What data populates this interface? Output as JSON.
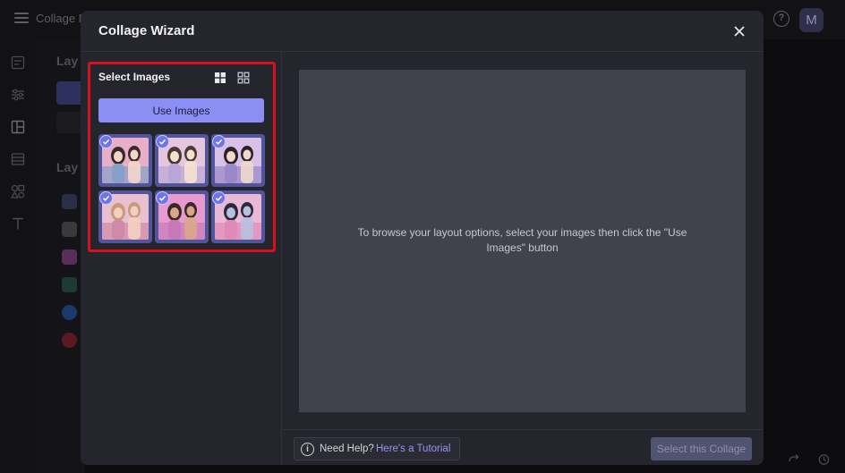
{
  "app": {
    "title": "Collage M",
    "avatar_letter": "M",
    "help_glyph": "?"
  },
  "background": {
    "panel_heading_1": "Lay",
    "panel_heading_2": "Lay"
  },
  "modal": {
    "title": "Collage Wizard",
    "close_icon": "close-icon"
  },
  "select_images": {
    "title": "Select Images",
    "use_button_label": "Use Images",
    "view_options": [
      "grid-large-icon",
      "grid-small-icon"
    ],
    "images": [
      {
        "selected": true,
        "palette": [
          "#e8b0c8",
          "#3a2a2a",
          "#f3d6c9",
          "#86a0c8"
        ]
      },
      {
        "selected": true,
        "palette": [
          "#e6c6dc",
          "#4a3a36",
          "#f5e1d0",
          "#b8a6d6"
        ]
      },
      {
        "selected": true,
        "palette": [
          "#d8c0e6",
          "#2a2228",
          "#f0d8cc",
          "#9a88c8"
        ]
      },
      {
        "selected": true,
        "palette": [
          "#e8c0d0",
          "#c89a7a",
          "#f3d0c0",
          "#d08aa8"
        ]
      },
      {
        "selected": true,
        "palette": [
          "#e89ad0",
          "#3a2a26",
          "#d8a68a",
          "#c87ab8"
        ]
      },
      {
        "selected": true,
        "palette": [
          "#e8b8d6",
          "#2a2a38",
          "#b8c0e0",
          "#e08ab8"
        ]
      }
    ]
  },
  "preview": {
    "message": "To browse your layout options, select your images then click the \"Use Images\" button"
  },
  "footer": {
    "need_help": "Need Help?",
    "tutorial_link": "Here's a Tutorial",
    "info_glyph": "i",
    "select_collage_label": "Select this Collage"
  },
  "colors": {
    "accent": "#8b8ef2",
    "highlight_border": "#d6121e",
    "modal_bg": "#25262d",
    "preview_bg": "#41434c"
  }
}
